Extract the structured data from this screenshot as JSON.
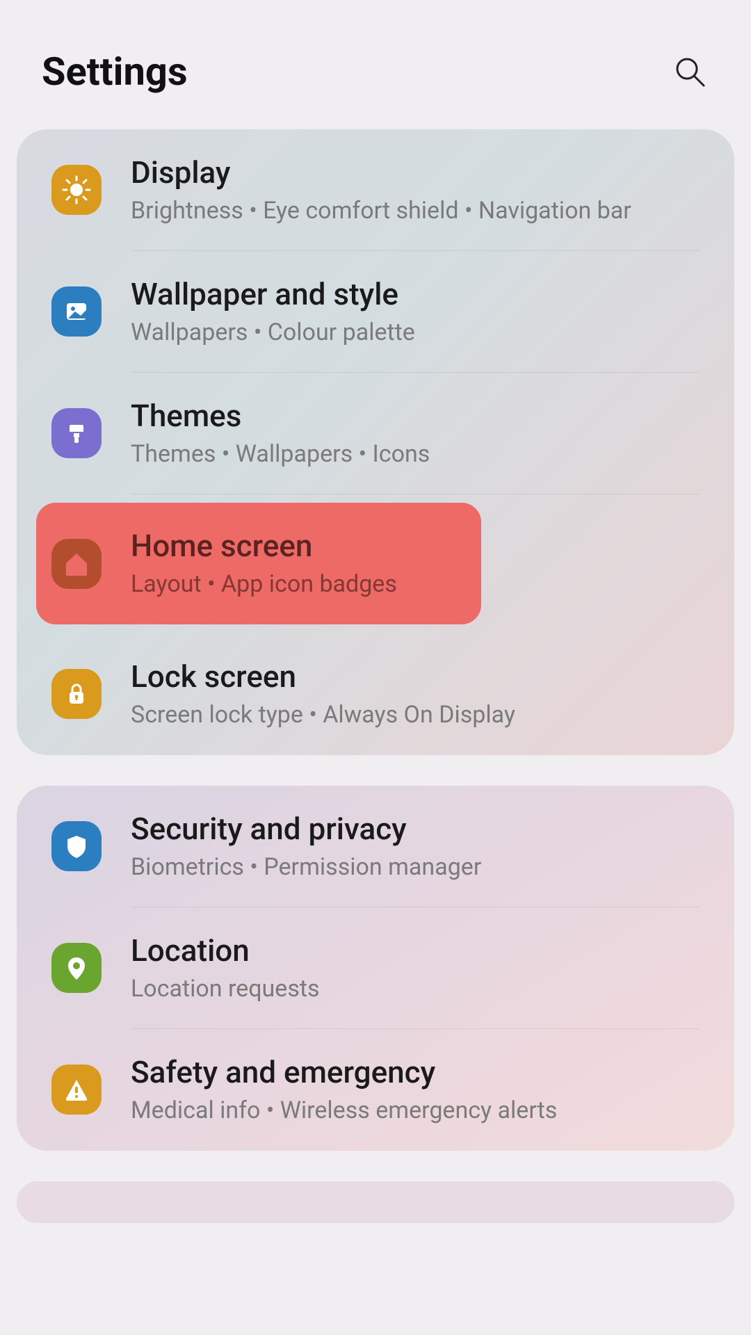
{
  "header": {
    "title": "Settings"
  },
  "groups": [
    {
      "items": [
        {
          "icon": "sun",
          "color": "#d99a1e",
          "title": "Display",
          "sub": "Brightness  •  Eye comfort shield  •  Navigation bar"
        },
        {
          "icon": "picture",
          "color": "#2b7fc0",
          "title": "Wallpaper and style",
          "sub": "Wallpapers  •  Colour palette"
        },
        {
          "icon": "brush",
          "color": "#7a6fd0",
          "title": "Themes",
          "sub": "Themes  •  Wallpapers  •  Icons"
        },
        {
          "icon": "home",
          "color": "#d99a1e",
          "title": "Home screen",
          "sub": "Layout  •  App icon badges",
          "highlighted": true,
          "highlight_color": "#ed6a66",
          "highlight_icon_color": "#b24e2e"
        },
        {
          "icon": "lock",
          "color": "#d99a1e",
          "title": "Lock screen",
          "sub": "Screen lock type  •  Always On Display"
        }
      ]
    },
    {
      "items": [
        {
          "icon": "shield",
          "color": "#2b7fc0",
          "title": "Security and privacy",
          "sub": "Biometrics  •  Permission manager"
        },
        {
          "icon": "pin",
          "color": "#6aa52f",
          "title": "Location",
          "sub": "Location requests"
        },
        {
          "icon": "alert",
          "color": "#d99a1e",
          "title": "Safety and emergency",
          "sub": "Medical info  •  Wireless emergency alerts"
        }
      ]
    }
  ]
}
